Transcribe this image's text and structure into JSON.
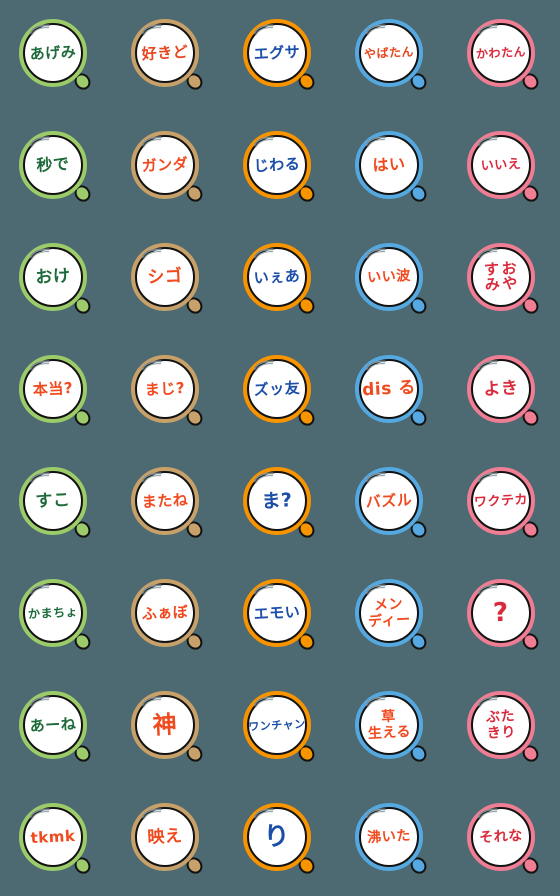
{
  "sheet": {
    "background_color": "#4d6a72",
    "columns": 5,
    "rows": 8,
    "style": "handwritten japanese slang words inside magnifying-glass / hand-mirror frames",
    "column_ring_colors": [
      "#9ccc6a",
      "#c8a06a",
      "#f79400",
      "#55a9e0",
      "#ef7d93"
    ],
    "glare_color": "#7a8a8f"
  },
  "items": [
    {
      "id": "agemi",
      "text": "あげみ",
      "lines": [
        "あげみ"
      ],
      "ring_color": "#9ccc6a",
      "text_color": "#1d6b3a",
      "font_size": 15,
      "layout": "single"
    },
    {
      "id": "sukido",
      "text": "好きど",
      "lines": [
        "好きど"
      ],
      "ring_color": "#c8a06a",
      "text_color": "#e8461e",
      "font_size": 15,
      "layout": "single"
    },
    {
      "id": "egusa",
      "text": "エグサ",
      "lines": [
        "エグサ"
      ],
      "ring_color": "#f79400",
      "text_color": "#1b4ea8",
      "font_size": 15,
      "layout": "single"
    },
    {
      "id": "yabatan",
      "text": "やばたん",
      "lines": [
        "やばたん"
      ],
      "ring_color": "#55a9e0",
      "text_color": "#e8461e",
      "font_size": 12,
      "layout": "single"
    },
    {
      "id": "kawatan",
      "text": "かわたん",
      "lines": [
        "かわたん"
      ],
      "ring_color": "#ef7d93",
      "text_color": "#d92b3c",
      "font_size": 12,
      "layout": "single"
    },
    {
      "id": "byoude",
      "text": "秒で",
      "lines": [
        "秒で"
      ],
      "ring_color": "#9ccc6a",
      "text_color": "#1d6b3a",
      "font_size": 16,
      "layout": "single"
    },
    {
      "id": "ganda",
      "text": "ガンダ",
      "lines": [
        "ガンダ"
      ],
      "ring_color": "#c8a06a",
      "text_color": "#f04a1e",
      "font_size": 15,
      "layout": "single"
    },
    {
      "id": "jiwaru",
      "text": "じわる",
      "lines": [
        "じわる"
      ],
      "ring_color": "#f79400",
      "text_color": "#1b4ea8",
      "font_size": 15,
      "layout": "single"
    },
    {
      "id": "hai",
      "text": "はい",
      "lines": [
        "はい"
      ],
      "ring_color": "#55a9e0",
      "text_color": "#f04a1e",
      "font_size": 16,
      "layout": "single"
    },
    {
      "id": "iie",
      "text": "いいえ",
      "lines": [
        "いいえ"
      ],
      "ring_color": "#ef7d93",
      "text_color": "#d92b3c",
      "font_size": 13,
      "layout": "single"
    },
    {
      "id": "oke",
      "text": "おけ",
      "lines": [
        "おけ"
      ],
      "ring_color": "#9ccc6a",
      "text_color": "#1d6b3a",
      "font_size": 17,
      "layout": "single"
    },
    {
      "id": "shigo",
      "text": "シゴ",
      "lines": [
        "シゴ"
      ],
      "ring_color": "#c8a06a",
      "text_color": "#f04a1e",
      "font_size": 17,
      "layout": "single"
    },
    {
      "id": "iea",
      "text": "いぇあ",
      "lines": [
        "いぇあ"
      ],
      "ring_color": "#f79400",
      "text_color": "#1b4ea8",
      "font_size": 15,
      "layout": "single"
    },
    {
      "id": "iinami",
      "text": "いい波",
      "lines": [
        "いい波"
      ],
      "ring_color": "#55a9e0",
      "text_color": "#f04a1e",
      "font_size": 14,
      "layout": "single"
    },
    {
      "id": "oyasumi",
      "text": "おやすみ",
      "lines": [
        "おや",
        "すみ"
      ],
      "ring_color": "#ef7d93",
      "text_color": "#d92b3c",
      "font_size": 15,
      "layout": "vertical"
    },
    {
      "id": "hontou",
      "text": "本当?",
      "lines": [
        "本当?"
      ],
      "ring_color": "#9ccc6a",
      "text_color": "#f04a1e",
      "font_size": 15,
      "layout": "single"
    },
    {
      "id": "maji",
      "text": "まじ?",
      "lines": [
        "まじ?"
      ],
      "ring_color": "#c8a06a",
      "text_color": "#f04a1e",
      "font_size": 15,
      "layout": "single"
    },
    {
      "id": "zuttomo",
      "text": "ズッ友",
      "lines": [
        "ズッ友"
      ],
      "ring_color": "#f79400",
      "text_color": "#1b4ea8",
      "font_size": 15,
      "layout": "single"
    },
    {
      "id": "disuru",
      "text": "dis る",
      "lines": [
        "dis る"
      ],
      "ring_color": "#55a9e0",
      "text_color": "#f04a1e",
      "font_size": 17,
      "layout": "single"
    },
    {
      "id": "yoki",
      "text": "よき",
      "lines": [
        "よき"
      ],
      "ring_color": "#ef7d93",
      "text_color": "#d92b3c",
      "font_size": 17,
      "layout": "single"
    },
    {
      "id": "suko",
      "text": "すこ",
      "lines": [
        "すこ"
      ],
      "ring_color": "#9ccc6a",
      "text_color": "#1d6b3a",
      "font_size": 17,
      "layout": "single"
    },
    {
      "id": "matane",
      "text": "またね",
      "lines": [
        "またね"
      ],
      "ring_color": "#c8a06a",
      "text_color": "#f04a1e",
      "font_size": 15,
      "layout": "single"
    },
    {
      "id": "ma",
      "text": "ま?",
      "lines": [
        "ま?"
      ],
      "ring_color": "#f79400",
      "text_color": "#1b4ea8",
      "font_size": 19,
      "layout": "single"
    },
    {
      "id": "bazuru",
      "text": "バズル",
      "lines": [
        "バズル"
      ],
      "ring_color": "#55a9e0",
      "text_color": "#f04a1e",
      "font_size": 15,
      "layout": "single"
    },
    {
      "id": "wakuteka",
      "text": "ワクテカ",
      "lines": [
        "ワクテカ"
      ],
      "ring_color": "#ef7d93",
      "text_color": "#d92b3c",
      "font_size": 13,
      "layout": "single"
    },
    {
      "id": "kamacho",
      "text": "かまちょ",
      "lines": [
        "かまちょ"
      ],
      "ring_color": "#9ccc6a",
      "text_color": "#1d6b3a",
      "font_size": 12,
      "layout": "single"
    },
    {
      "id": "fabo",
      "text": "ふぁぼ",
      "lines": [
        "ふぁぼ"
      ],
      "ring_color": "#c8a06a",
      "text_color": "#f04a1e",
      "font_size": 15,
      "layout": "single"
    },
    {
      "id": "emoi",
      "text": "エモい",
      "lines": [
        "エモい"
      ],
      "ring_color": "#f79400",
      "text_color": "#1b4ea8",
      "font_size": 15,
      "layout": "single"
    },
    {
      "id": "mendi",
      "text": "メンディー",
      "lines": [
        "メン",
        "ディー"
      ],
      "ring_color": "#55a9e0",
      "text_color": "#f04a1e",
      "font_size": 14,
      "layout": "two-line"
    },
    {
      "id": "question",
      "text": "?",
      "lines": [
        "?"
      ],
      "ring_color": "#ef7d93",
      "text_color": "#d92b3c",
      "font_size": 26,
      "layout": "single"
    },
    {
      "id": "aane",
      "text": "あーね",
      "lines": [
        "あーね"
      ],
      "ring_color": "#9ccc6a",
      "text_color": "#1d6b3a",
      "font_size": 15,
      "layout": "single"
    },
    {
      "id": "kami",
      "text": "神",
      "lines": [
        "神"
      ],
      "ring_color": "#c8a06a",
      "text_color": "#f04a1e",
      "font_size": 24,
      "layout": "single"
    },
    {
      "id": "wanchan",
      "text": "ワンチャン",
      "lines": [
        "ワンチャン"
      ],
      "ring_color": "#f79400",
      "text_color": "#1b4ea8",
      "font_size": 11,
      "layout": "single"
    },
    {
      "id": "kusahaeru",
      "text": "草生える",
      "lines": [
        "草",
        "生える"
      ],
      "ring_color": "#55a9e0",
      "text_color": "#f04a1e",
      "font_size": 14,
      "layout": "two-line"
    },
    {
      "id": "butakiri",
      "text": "ぶたきり",
      "lines": [
        "ぶた",
        "きり"
      ],
      "ring_color": "#ef7d93",
      "text_color": "#d92b3c",
      "font_size": 14,
      "layout": "two-line"
    },
    {
      "id": "tkmk",
      "text": "tkmk",
      "lines": [
        "tkmk"
      ],
      "ring_color": "#9ccc6a",
      "text_color": "#f04a1e",
      "font_size": 15,
      "layout": "single"
    },
    {
      "id": "bae",
      "text": "映え",
      "lines": [
        "映え"
      ],
      "ring_color": "#c8a06a",
      "text_color": "#f04a1e",
      "font_size": 17,
      "layout": "single"
    },
    {
      "id": "ri",
      "text": "り",
      "lines": [
        "り"
      ],
      "ring_color": "#f79400",
      "text_color": "#1b4ea8",
      "font_size": 26,
      "layout": "single"
    },
    {
      "id": "waita",
      "text": "沸いた",
      "lines": [
        "沸いた"
      ],
      "ring_color": "#55a9e0",
      "text_color": "#f04a1e",
      "font_size": 14,
      "layout": "single"
    },
    {
      "id": "sorena",
      "text": "それな",
      "lines": [
        "それな"
      ],
      "ring_color": "#ef7d93",
      "text_color": "#d92b3c",
      "font_size": 14,
      "layout": "single"
    }
  ]
}
